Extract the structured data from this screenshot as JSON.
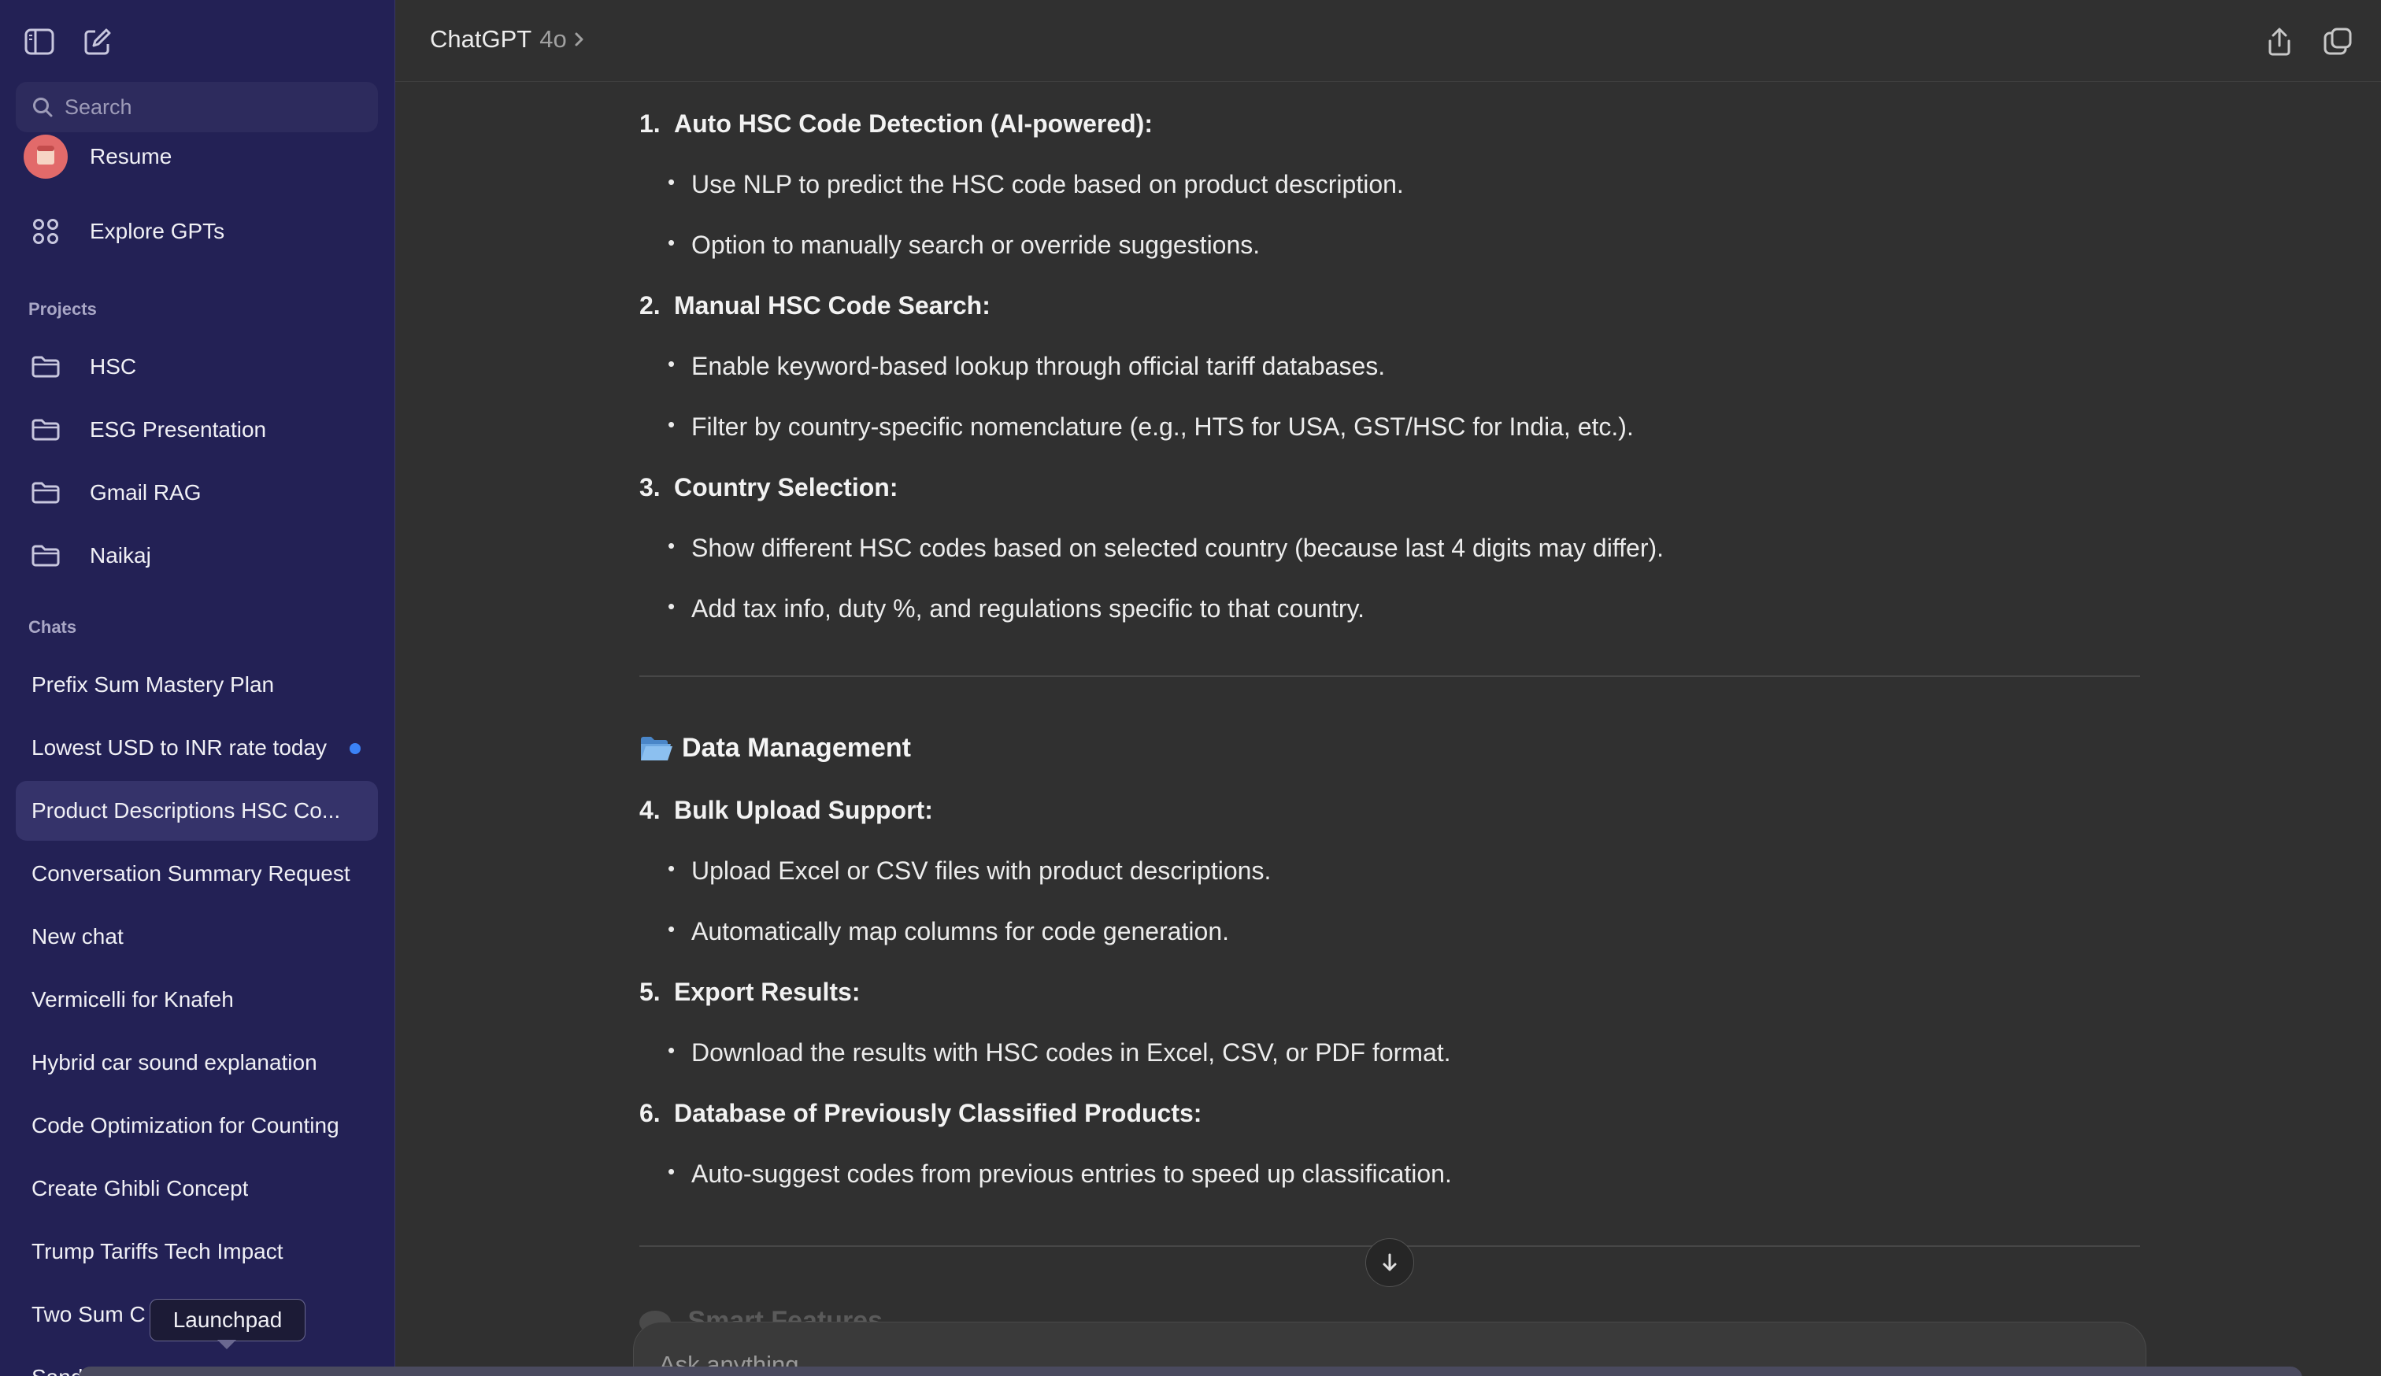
{
  "sidebar": {
    "search_placeholder": "Search",
    "top_items": [
      {
        "label": "Resume",
        "icon": "resume-avatar-icon"
      },
      {
        "label": "Explore GPTs",
        "icon": "grid-icon"
      }
    ],
    "projects_header": "Projects",
    "projects": [
      "HSC",
      "ESG Presentation",
      "Gmail RAG",
      "Naikaj"
    ],
    "chats_header": "Chats",
    "chats": [
      "Prefix Sum Mastery Plan",
      "Lowest USD to INR rate today",
      "Product Descriptions HSC Co...",
      "Conversation Summary Request",
      "New chat",
      "Vermicelli for Knafeh",
      "Hybrid car sound explanation",
      "Code Optimization for Counting",
      "Create Ghibli Concept",
      "Trump Tariffs Tech Impact",
      "Two Sum C",
      "Sand"
    ],
    "tooltip": "Launchpad"
  },
  "header": {
    "model_name": "ChatGPT",
    "model_version": "4o",
    "chevron": ">"
  },
  "content": {
    "items": [
      {
        "num": "1.",
        "title": "Auto HSC Code Detection (AI-powered):",
        "bullets": [
          "Use NLP to predict the HSC code based on product description.",
          "Option to manually search or override suggestions."
        ]
      },
      {
        "num": "2.",
        "title": "Manual HSC Code Search:",
        "bullets": [
          "Enable keyword-based lookup through official tariff databases.",
          "Filter by country-specific nomenclature (e.g., HTS for USA, GST/HSC for India, etc.)."
        ]
      },
      {
        "num": "3.",
        "title": "Country Selection:",
        "bullets": [
          "Show different HSC codes based on selected country (because last 4 digits may differ).",
          "Add tax info, duty %, and regulations specific to that country."
        ]
      },
      {
        "num": "4.",
        "title": "Bulk Upload Support:",
        "bullets": [
          "Upload Excel or CSV files with product descriptions.",
          "Automatically map columns for code generation."
        ]
      },
      {
        "num": "5.",
        "title": "Export Results:",
        "bullets": [
          "Download the results with HSC codes in Excel, CSV, or PDF format."
        ]
      },
      {
        "num": "6.",
        "title": "Database of Previously Classified Products:",
        "bullets": [
          "Auto-suggest codes from previous entries to speed up classification."
        ]
      }
    ],
    "section_data_management": "Data Management",
    "section_smart_features": "Smart Features",
    "bullet_char": "•"
  },
  "composer": {
    "placeholder": "Ask anything"
  },
  "colors": {
    "sidebar_bg": "#232155",
    "main_bg": "#303030",
    "unread_dot": "#3b82f6"
  }
}
